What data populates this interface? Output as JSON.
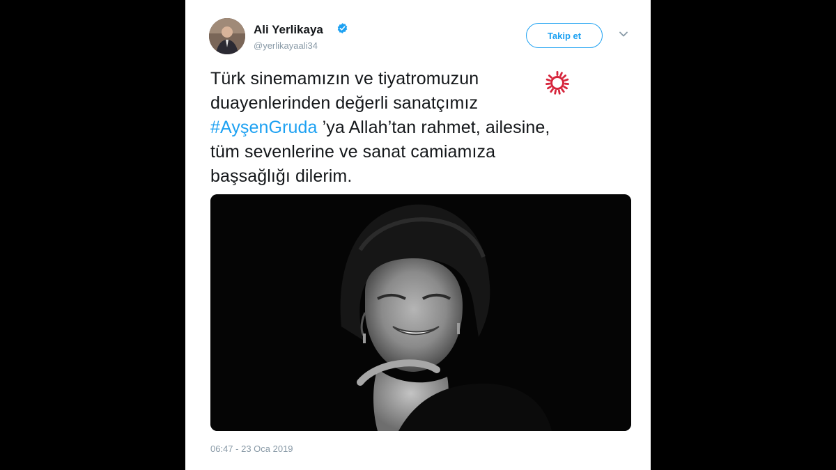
{
  "tweet": {
    "author_name": "Ali Yerlikaya",
    "handle": "@yerlikayaali34",
    "follow_label": "Takip et",
    "text_lines": [
      "Türk sinemamızın ve tiyatromuzun",
      "duayenlerinden değerli sanatçımız"
    ],
    "hashtag": "#AyşenGruda",
    "text_after_hashtag": " ’ya Allah’tan rahmet, ailesine,",
    "text_lines_end": [
      "tüm sevenlerine ve sanat camiamıza",
      "başsağlığı dilerim."
    ],
    "timestamp": "06:47 - 23 Oca 2019"
  },
  "icons": {
    "verified": "verified-badge-icon",
    "caret": "chevron-down-icon",
    "brand": "circular-logo-icon"
  },
  "colors": {
    "accent": "#1da1f2",
    "text": "#14171a",
    "muted": "#8899a6",
    "brand_logo": "#d6243b"
  }
}
